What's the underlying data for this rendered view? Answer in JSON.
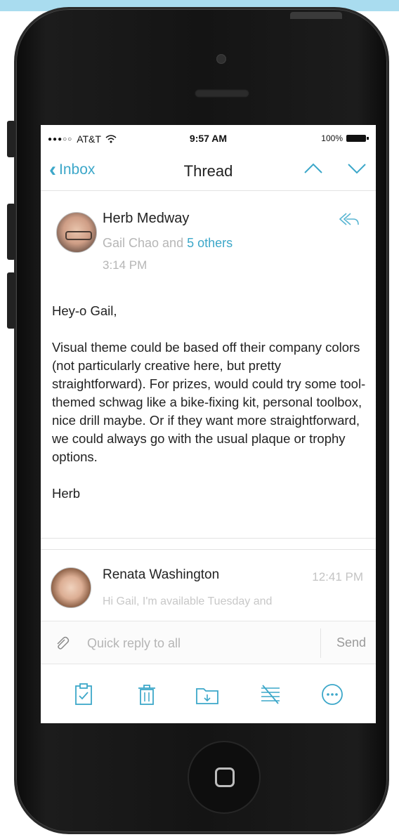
{
  "status_bar": {
    "carrier": "AT&T",
    "signal_dots": "●●●○○",
    "time": "9:57 AM",
    "battery": "100%"
  },
  "nav": {
    "back_label": "Inbox",
    "title": "Thread",
    "icons": [
      "chevron-left-icon",
      "chevron-up-icon",
      "chevron-down-icon"
    ]
  },
  "message": {
    "sender": "Herb Medway",
    "recipients_prefix": "Gail Chao and ",
    "recipients_others": "5 others",
    "time": "3:14 PM",
    "greeting": "Hey-o Gail,",
    "body": "Visual theme could be based off their company colors (not particularly creative here, but pretty straightforward). For prizes, would could try some tool-themed schwag like a bike-fixing kit, personal toolbox, nice drill maybe. Or if they want more straightforward, we could always go with the usual plaque or trophy options.",
    "signature": "Herb"
  },
  "preview": {
    "sender": "Renata Washington",
    "time": "12:41 PM",
    "snippet": "Hi Gail, I'm available Tuesday and"
  },
  "reply": {
    "placeholder": "Quick reply to all",
    "send_label": "Send"
  },
  "toolbar": {
    "icons": [
      "clipboard-check-icon",
      "trash-icon",
      "folder-move-icon",
      "mark-icon",
      "more-icon"
    ]
  },
  "colors": {
    "accent": "#3ca7c9",
    "top_band": "#a9dcef",
    "phone_body": "#141414"
  }
}
